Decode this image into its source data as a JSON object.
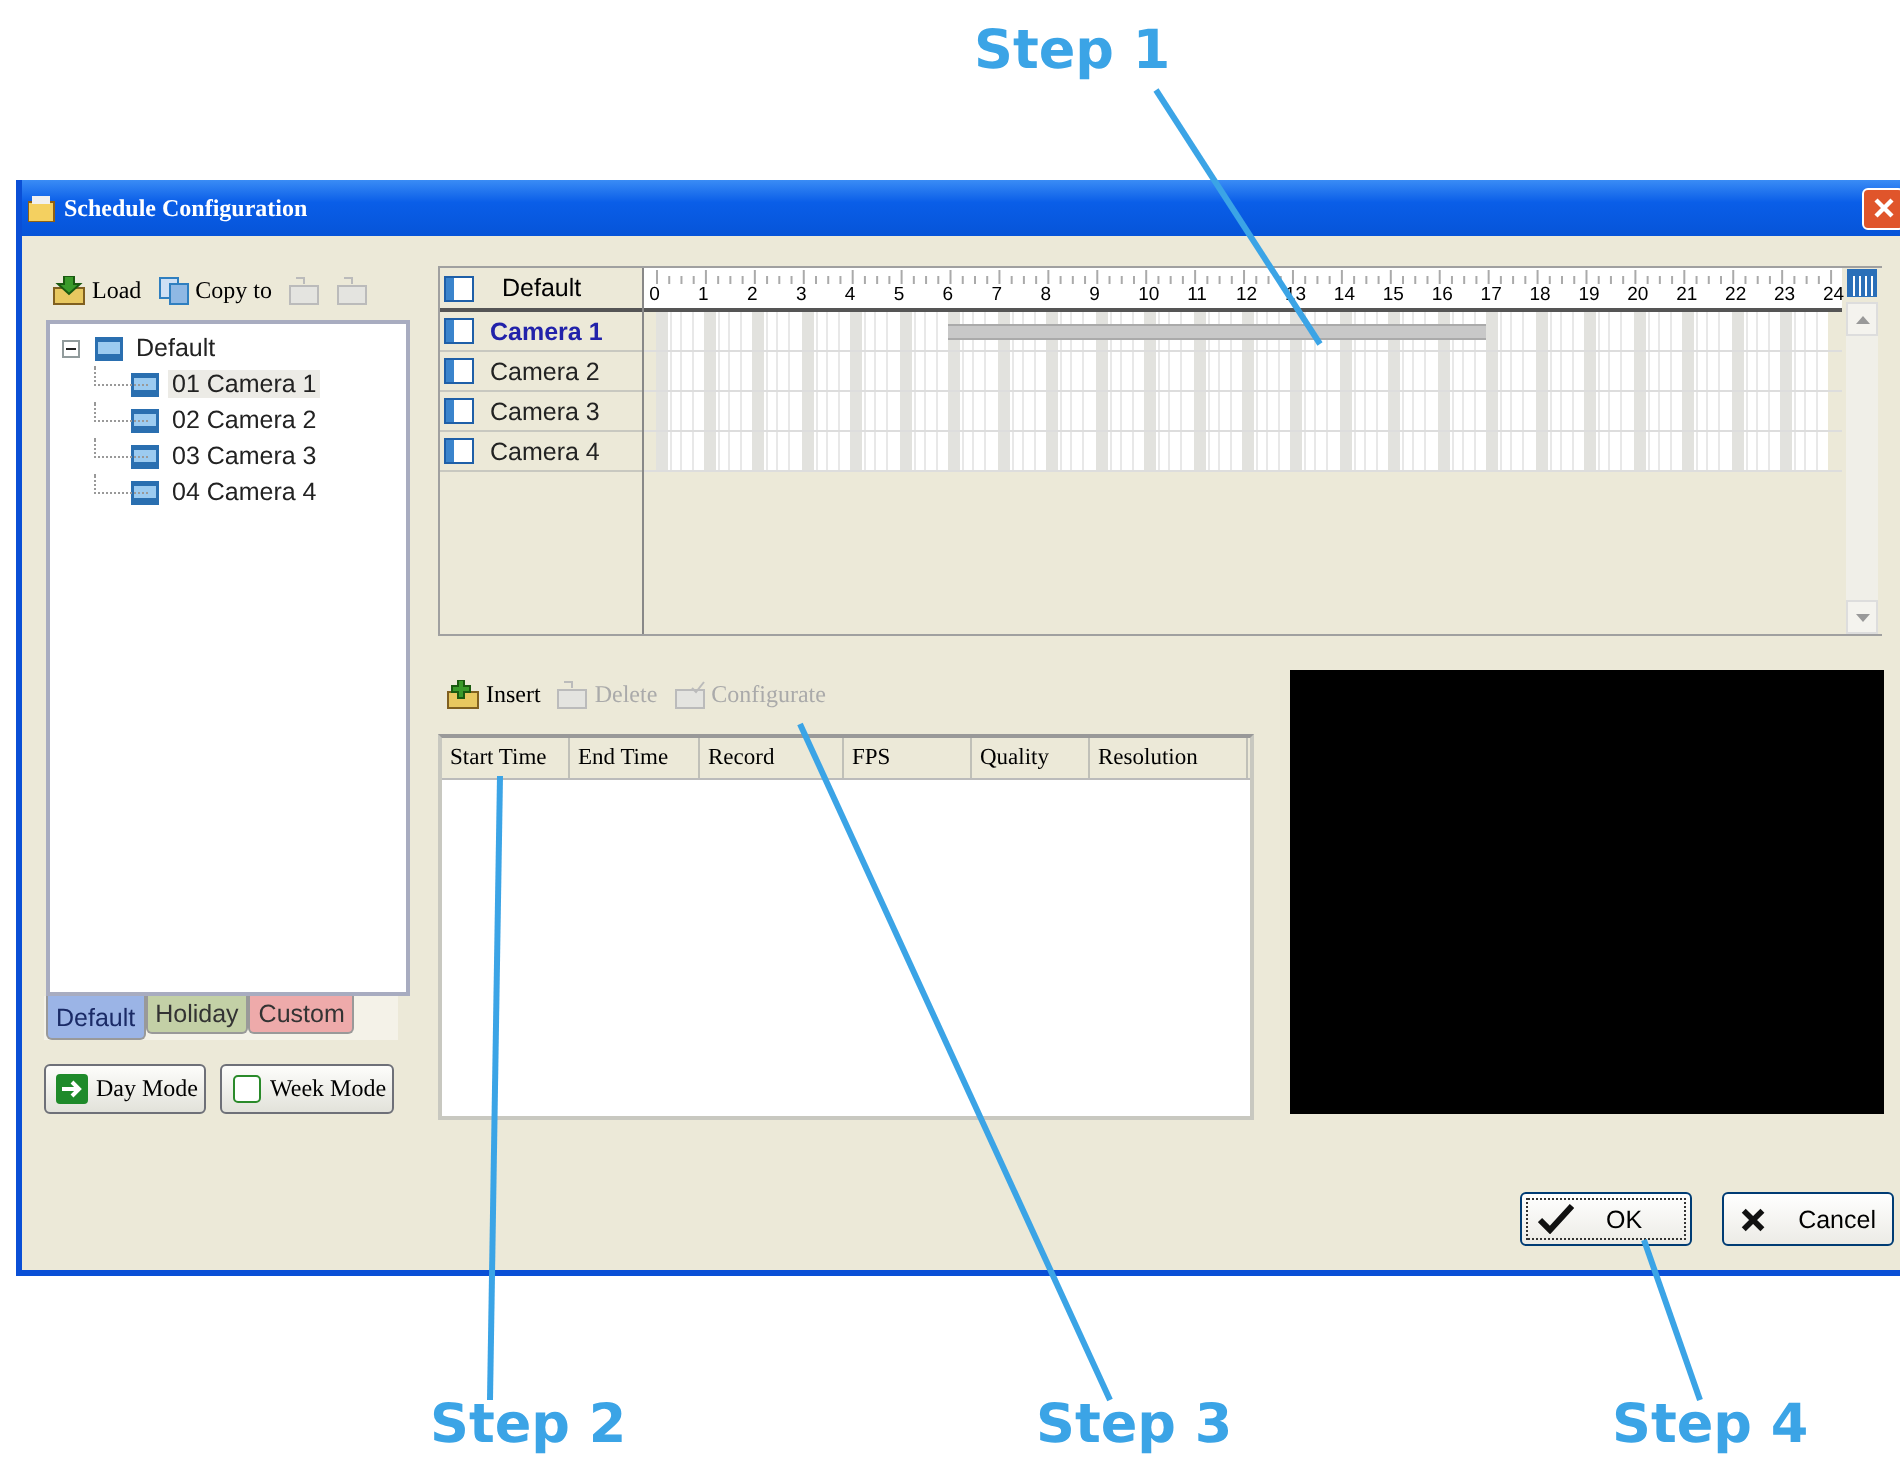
{
  "window": {
    "title": "Schedule Configuration"
  },
  "annotations": [
    {
      "label": "Step 1"
    },
    {
      "label": "Step 2"
    },
    {
      "label": "Step 3"
    },
    {
      "label": "Step 4"
    }
  ],
  "group_toolbar": [
    {
      "kind": "load",
      "label": "Load",
      "disabled": false
    },
    {
      "kind": "copy",
      "label": "Copy to",
      "disabled": false
    },
    {
      "kind": "add",
      "disabled": true
    },
    {
      "kind": "remove",
      "disabled": true
    }
  ],
  "tree": {
    "label": "Default",
    "expanded": true,
    "children": [
      {
        "label": "01 Camera 1",
        "selected": true
      },
      {
        "label": "02 Camera 2",
        "selected": false
      },
      {
        "label": "03 Camera 3",
        "selected": false
      },
      {
        "label": "04 Camera 4",
        "selected": false
      }
    ]
  },
  "schedule_tabs": [
    {
      "label": "Default",
      "selected": true,
      "color": "#9bb4e6"
    },
    {
      "label": "Holiday",
      "selected": false,
      "color": "#c3d0a6"
    },
    {
      "label": "Custom",
      "selected": false,
      "color": "#eeaaaa"
    }
  ],
  "mode_buttons": [
    {
      "kind": "day",
      "label": "Day Mode"
    },
    {
      "kind": "week",
      "label": "Week Mode"
    }
  ],
  "timeline": {
    "header": "Default",
    "hours": [
      "0",
      "1",
      "2",
      "3",
      "4",
      "5",
      "6",
      "7",
      "8",
      "9",
      "10",
      "11",
      "12",
      "13",
      "14",
      "15",
      "16",
      "17",
      "18",
      "19",
      "20",
      "21",
      "22",
      "23",
      "24"
    ],
    "rows": [
      {
        "label": "Camera 1",
        "selected": true,
        "scheduled_hours": [
          false,
          false,
          false,
          false,
          false,
          false,
          true,
          true,
          true,
          true,
          true,
          true,
          true,
          true,
          true,
          true,
          true,
          false,
          false,
          false,
          false,
          false,
          false,
          false
        ]
      },
      {
        "label": "Camera 2",
        "selected": false,
        "scheduled_hours": [
          false,
          false,
          false,
          false,
          false,
          false,
          false,
          false,
          false,
          false,
          false,
          false,
          false,
          false,
          false,
          false,
          false,
          false,
          false,
          false,
          false,
          false,
          false,
          false
        ]
      },
      {
        "label": "Camera 3",
        "selected": false,
        "scheduled_hours": [
          false,
          false,
          false,
          false,
          false,
          false,
          false,
          false,
          false,
          false,
          false,
          false,
          false,
          false,
          false,
          false,
          false,
          false,
          false,
          false,
          false,
          false,
          false,
          false
        ]
      },
      {
        "label": "Camera 4",
        "selected": false,
        "scheduled_hours": [
          false,
          false,
          false,
          false,
          false,
          false,
          false,
          false,
          false,
          false,
          false,
          false,
          false,
          false,
          false,
          false,
          false,
          false,
          false,
          false,
          false,
          false,
          false,
          false
        ]
      }
    ]
  },
  "entry_toolbar": [
    {
      "kind": "insert",
      "label": "Insert",
      "disabled": false
    },
    {
      "kind": "delete",
      "label": "Delete",
      "disabled": true
    },
    {
      "kind": "configure",
      "label": "Configurate",
      "disabled": true
    }
  ],
  "entry_table": {
    "columns": [
      "Start Time",
      "End Time",
      "Record",
      "FPS",
      "Quality",
      "Resolution"
    ]
  },
  "buttons": [
    {
      "kind": "ok",
      "label": "OK",
      "focused": true
    },
    {
      "kind": "cancel",
      "label": "Cancel",
      "focused": false
    }
  ]
}
